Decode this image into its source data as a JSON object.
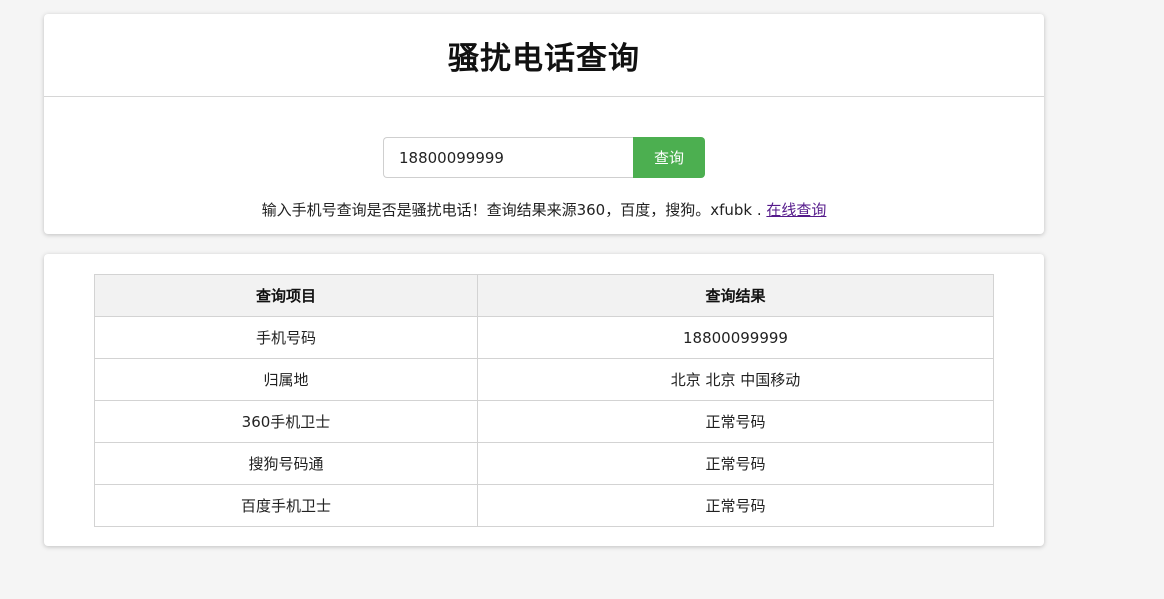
{
  "page": {
    "title": "骚扰电话查询"
  },
  "search": {
    "value": "18800099999",
    "button_label": "查询"
  },
  "note": {
    "text": "输入手机号查询是否是骚扰电话！查询结果来源360，百度，搜狗。xfubk . ",
    "link_label": "在线查询"
  },
  "table": {
    "headers": [
      "查询项目",
      "查询结果"
    ],
    "rows": [
      {
        "item": "手机号码",
        "result": "18800099999"
      },
      {
        "item": "归属地",
        "result": "北京 北京 中国移动"
      },
      {
        "item": "360手机卫士",
        "result": "正常号码"
      },
      {
        "item": "搜狗号码通",
        "result": "正常号码"
      },
      {
        "item": "百度手机卫士",
        "result": "正常号码"
      }
    ]
  },
  "colors": {
    "accent": "#4caf50",
    "link": "#551a8b",
    "background": "#f5f5f5"
  }
}
